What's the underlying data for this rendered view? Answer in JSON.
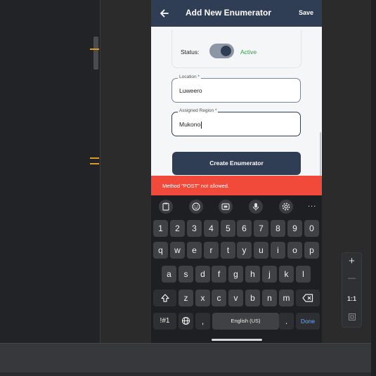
{
  "app": {
    "title": "Add New Enumerator",
    "save_label": "Save"
  },
  "form": {
    "status_label": "Status:",
    "status_value": "Active",
    "location_label": "Location *",
    "location_value": "Luweero",
    "region_label": "Assigned Region *",
    "region_value": "Mukono",
    "create_label": "Create Enumerator"
  },
  "snackbar": {
    "message": "Method \"POST\" not allowed."
  },
  "keyboard": {
    "row_numbers": [
      "1",
      "2",
      "3",
      "4",
      "5",
      "6",
      "7",
      "8",
      "9",
      "0"
    ],
    "row_top": [
      "q",
      "w",
      "e",
      "r",
      "t",
      "y",
      "u",
      "i",
      "o",
      "p"
    ],
    "row_middle": [
      "a",
      "s",
      "d",
      "f",
      "g",
      "h",
      "j",
      "k",
      "l"
    ],
    "row_bottom": [
      "z",
      "x",
      "c",
      "v",
      "b",
      "n",
      "m"
    ],
    "symbols_label": "!#1",
    "comma": ",",
    "space_label": "English (US)",
    "period": ".",
    "done_label": "Done",
    "more_label": "..."
  },
  "zoom": {
    "plus": "+",
    "minus": "—",
    "ratio": "1:1"
  },
  "colors": {
    "appbar": "#2f3e54",
    "active_green": "#2e9e4a",
    "error_red": "#f14a3a",
    "done_blue": "#6aa6ff"
  }
}
